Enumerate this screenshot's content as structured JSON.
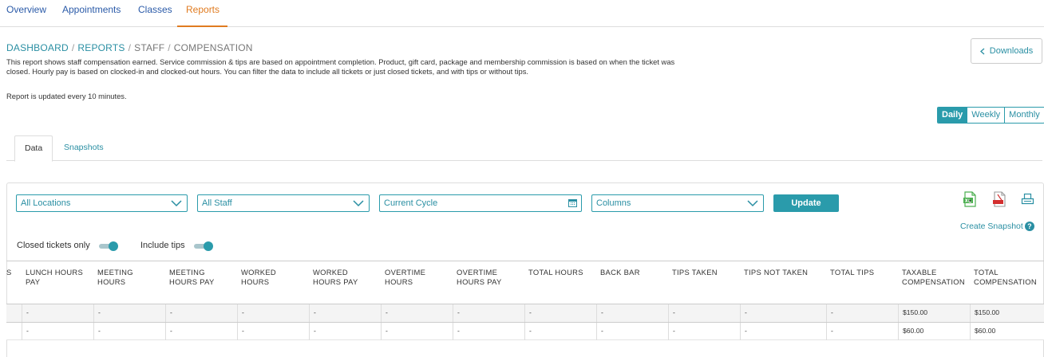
{
  "nav": {
    "tabs": [
      {
        "label": "Overview"
      },
      {
        "label": "Appointments"
      },
      {
        "label": "Classes"
      },
      {
        "label": "Reports"
      }
    ]
  },
  "breadcrumb": {
    "dashboard": "DASHBOARD",
    "reports": "REPORTS",
    "staff": "STAFF",
    "current": "COMPENSATION",
    "separator": "/"
  },
  "description": "This report shows staff compensation earned. Service commission & tips are based on appointment completion. Product, gift card, package and membership commission is based on when the ticket was closed. Hourly pay is based on clocked-in and clocked-out hours. You can filter the data to include all tickets or just closed tickets, and with tips or without tips.",
  "update_note": "Report is updated every 10 minutes.",
  "downloads_label": "Downloads",
  "period": {
    "daily": "Daily",
    "weekly": "Weekly",
    "monthly": "Monthly"
  },
  "subtabs": {
    "data": "Data",
    "snapshots": "Snapshots"
  },
  "filters": {
    "locations": "All Locations",
    "staff": "All Staff",
    "cycle": "Current Cycle",
    "columns": "Columns",
    "update": "Update"
  },
  "create_snapshot": "Create Snapshot",
  "help_glyph": "?",
  "toggles": {
    "closed_only": "Closed tickets only",
    "include_tips": "Include tips"
  },
  "table": {
    "clipped_header": "S",
    "headers": [
      "LUNCH HOURS PAY",
      "MEETING HOURS",
      "MEETING HOURS PAY",
      "WORKED HOURS",
      "WORKED HOURS PAY",
      "OVERTIME HOURS",
      "OVERTIME HOURS PAY",
      "TOTAL HOURS",
      "BACK BAR",
      "TIPS TAKEN",
      "TIPS NOT TAKEN",
      "TOTAL TIPS",
      "TAXABLE COMPENSATION",
      "TOTAL COMPENSATION"
    ],
    "rows": [
      [
        "-",
        "-",
        "-",
        "-",
        "-",
        "-",
        "-",
        "-",
        "-",
        "-",
        "-",
        "-",
        "$150.00",
        "$150.00"
      ],
      [
        "-",
        "-",
        "-",
        "-",
        "-",
        "-",
        "-",
        "-",
        "-",
        "-",
        "-",
        "-",
        "$60.00",
        "$60.00"
      ]
    ]
  },
  "colors": {
    "accent": "#2a9bab",
    "active_tab": "#e07b20",
    "nav_link": "#2a5aa8"
  }
}
